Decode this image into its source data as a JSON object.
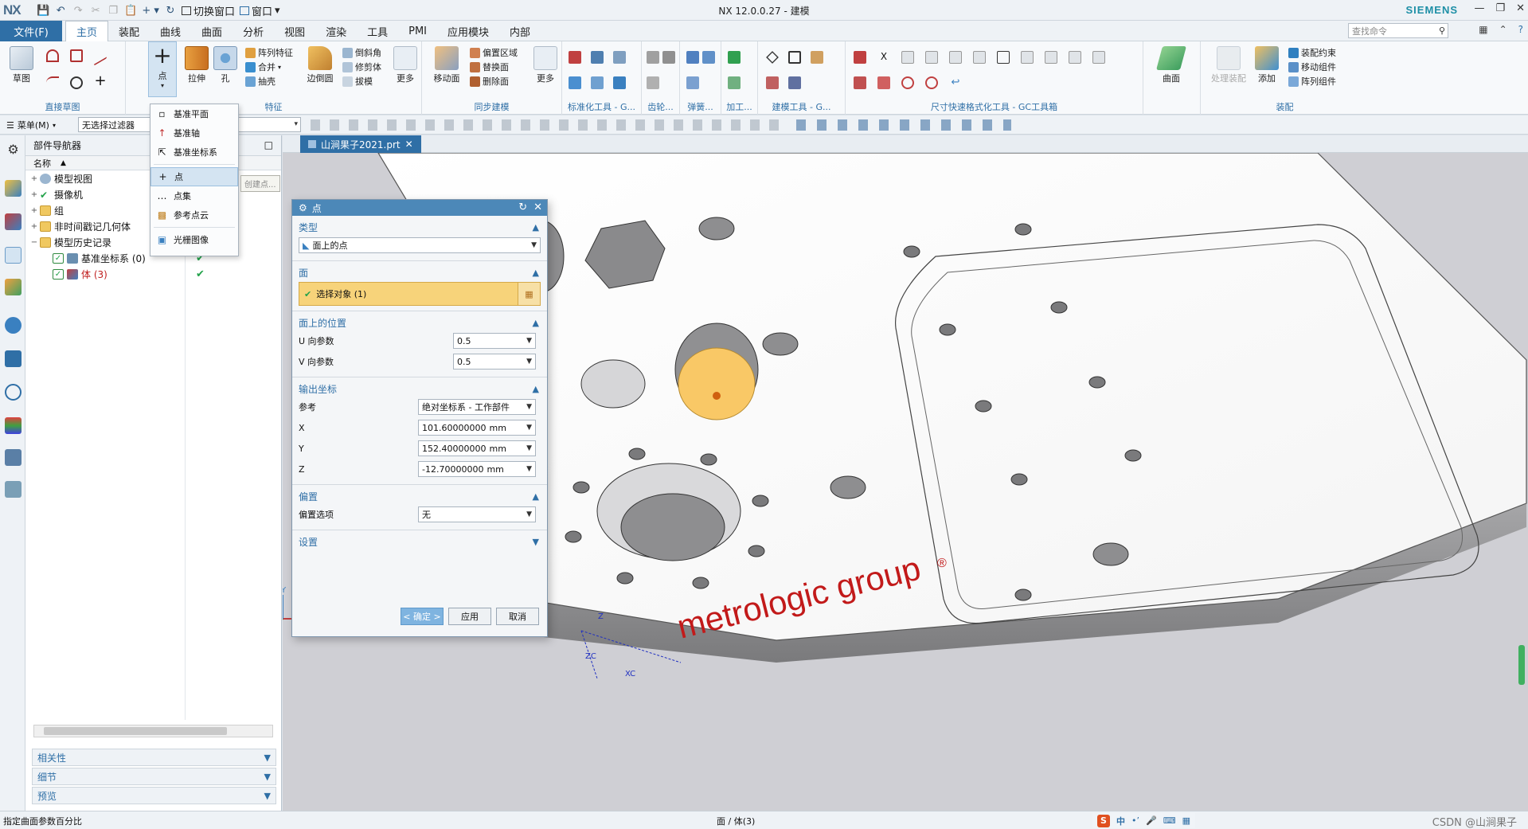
{
  "app": {
    "logo": "NX",
    "title": "NX 12.0.0.27 - 建模",
    "brand": "SIEMENS",
    "quick_access": [
      "切换窗口",
      "窗口"
    ]
  },
  "menubar": {
    "file": "文件(F)",
    "tabs": [
      "主页",
      "装配",
      "曲线",
      "曲面",
      "分析",
      "视图",
      "渲染",
      "工具",
      "PMI",
      "应用模块",
      "内部"
    ],
    "active_tab": "主页",
    "search_placeholder": "查找命令"
  },
  "ribbon": {
    "groups": {
      "sketch": {
        "label": "直接草图",
        "big": "草图"
      },
      "feature": {
        "label": "特征",
        "point": "点",
        "extrude": "拉伸",
        "hole": "孔",
        "small": [
          "阵列特征",
          "合并",
          "抽壳",
          "倒斜角",
          "修剪体",
          "拔模"
        ],
        "edge_blend": "边倒圆",
        "more": "更多"
      },
      "sync": {
        "label": "同步建模",
        "move_face": "移动面",
        "small": [
          "偏置区域",
          "替换面",
          "删除面"
        ],
        "more": "更多"
      },
      "std": {
        "label": "标准化工具 - G..."
      },
      "gear": {
        "label": "齿轮..."
      },
      "spring": {
        "label": "弹簧..."
      },
      "machining": {
        "label": "加工..."
      },
      "modeling_tools": {
        "label": "建模工具 - G..."
      },
      "dim": {
        "label": "尺寸快速格式化工具 - GC工具箱"
      },
      "surface": {
        "label": "曲面"
      },
      "assembly": {
        "label": "装配",
        "process": "处理装配",
        "add": "添加",
        "small": [
          "装配约束",
          "移动组件",
          "阵列组件"
        ]
      }
    }
  },
  "filterbar": {
    "menu": "菜单(M)",
    "filter": "无选择过滤器"
  },
  "navigator": {
    "title": "部件导航器",
    "column": "名称",
    "rows": [
      {
        "label": "模型视图",
        "indent": 0
      },
      {
        "label": "摄像机",
        "indent": 0
      },
      {
        "label": "组",
        "indent": 0
      },
      {
        "label": "非时间戳记几何体",
        "indent": 0
      },
      {
        "label": "模型历史记录",
        "indent": 0
      },
      {
        "label": "基准坐标系 (0)",
        "indent": 1
      },
      {
        "label": "体 (3)",
        "indent": 1
      }
    ],
    "panels": [
      "相关性",
      "细节",
      "预览"
    ]
  },
  "dropdown": {
    "items": [
      "基准平面",
      "基准轴",
      "基准坐标系",
      "点",
      "点集",
      "参考点云",
      "光栅图像"
    ],
    "highlighted": "点",
    "tooltip": "创建点..."
  },
  "viewport": {
    "tab": "山涧果子2021.prt",
    "logo_text": "metrologic group",
    "registered": "®",
    "axis": [
      "X",
      "Y",
      "Z",
      "ZC",
      "XC"
    ]
  },
  "dialog": {
    "title": "点",
    "type_section": "类型",
    "type_value": "面上的点",
    "face_section": "面",
    "select_object": "选择对象 (1)",
    "position_section": "面上的位置",
    "u_label": "U 向参数",
    "u_value": "0.5",
    "v_label": "V 向参数",
    "v_value": "0.5",
    "output_section": "输出坐标",
    "ref_label": "参考",
    "ref_value": "绝对坐标系 - 工作部件",
    "x_label": "X",
    "x_value": "101.60000000",
    "y_label": "Y",
    "y_value": "152.40000000",
    "z_label": "Z",
    "z_value": "-12.70000000",
    "unit": "mm",
    "offset_section": "偏置",
    "offset_label": "偏置选项",
    "offset_value": "无",
    "settings_section": "设置",
    "ok": "< 确定 >",
    "apply": "应用",
    "cancel": "取消"
  },
  "status": {
    "left": "指定曲面参数百分比",
    "center": "面 / 体(3)",
    "watermark": "CSDN @山涧果子",
    "ime": "中"
  },
  "colors": {
    "accent": "#2f6fa6",
    "dialog_title": "#4c88b8",
    "selection": "#f7d37a",
    "highlight_face": "#f9c866"
  }
}
